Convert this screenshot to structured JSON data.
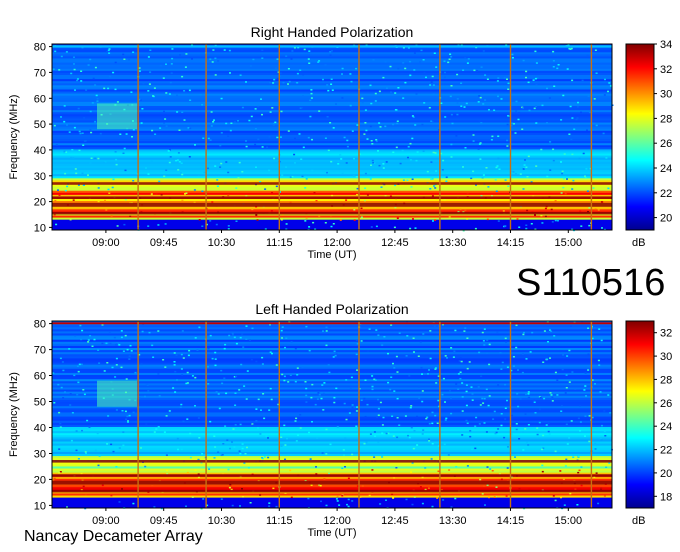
{
  "figure": {
    "station_label": "S110516",
    "footer": "Nancay Decameter Array"
  },
  "colors": {
    "scale": [
      "#00008f",
      "#0000ff",
      "#0080ff",
      "#00ffff",
      "#80ff80",
      "#ffff00",
      "#ff8000",
      "#ff0000",
      "#800000"
    ],
    "vertical_lines": "#c87010",
    "horizontal_band": "#8b0000"
  },
  "chart_data": [
    {
      "type": "heatmap",
      "title": "Right Handed Polarization",
      "xlabel": "Time (UT)",
      "ylabel": "Frequency (MHz)",
      "x_ticks": [
        "09:00",
        "09:45",
        "10:30",
        "11:15",
        "12:00",
        "12:45",
        "13:30",
        "14:15",
        "15:00"
      ],
      "y_ticks": [
        10,
        20,
        30,
        40,
        50,
        60,
        70,
        80
      ],
      "ylim": [
        9,
        81
      ],
      "colorbar": {
        "label": "dB",
        "ticks": [
          20,
          22,
          24,
          26,
          28,
          30,
          32,
          34
        ],
        "range": [
          19,
          34
        ]
      },
      "event_times": [
        "09:25",
        "10:18",
        "11:15",
        "12:17",
        "13:20",
        "14:15",
        "15:18"
      ]
    },
    {
      "type": "heatmap",
      "title": "Left Handed Polarization",
      "xlabel": "Time (UT)",
      "ylabel": "Frequency (MHz)",
      "x_ticks": [
        "09:00",
        "09:45",
        "10:30",
        "11:15",
        "12:00",
        "12:45",
        "13:30",
        "14:15",
        "15:00"
      ],
      "y_ticks": [
        10,
        20,
        30,
        40,
        50,
        60,
        70,
        80
      ],
      "ylim": [
        9,
        81
      ],
      "colorbar": {
        "label": "dB",
        "ticks": [
          18,
          20,
          22,
          24,
          26,
          28,
          30,
          32
        ],
        "range": [
          17,
          33
        ]
      },
      "event_times": [
        "09:25",
        "10:18",
        "11:15",
        "12:17",
        "13:20",
        "14:15",
        "15:18"
      ]
    }
  ]
}
